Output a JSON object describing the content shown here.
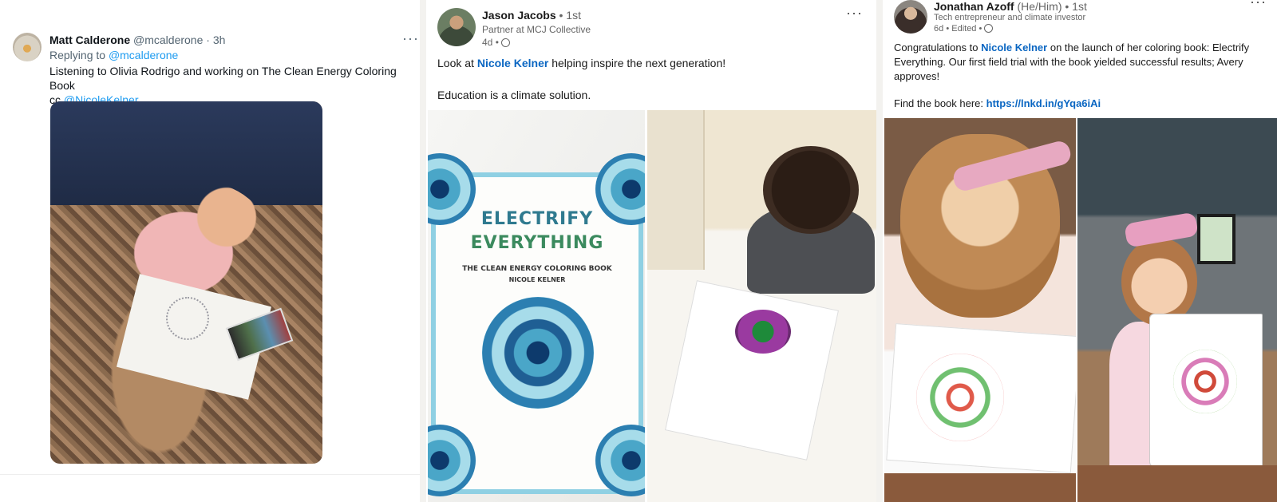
{
  "tweet": {
    "author_name": "Matt Calderone",
    "author_handle": "@mcalderone",
    "time": "3h",
    "more": "···",
    "replying_prefix": "Replying to",
    "replying_handle": "@mcalderone",
    "text": "Listening to Olivia Rodrigo and working on The Clean Energy Coloring Book",
    "cc_prefix": "cc",
    "cc_handle": "@NicoleKelner"
  },
  "post1": {
    "author_name": "Jason Jacobs",
    "degree": "1st",
    "headline": "Partner at MCJ Collective",
    "time": "4d",
    "more": "···",
    "text_prefix": "Look at",
    "mention": "Nicole Kelner",
    "text_suffix": "helping inspire the next generation!",
    "text_line2": "Education is a climate solution.",
    "book_title_1": "ELECTRIFY",
    "book_title_2": "EVERYTHING",
    "book_subtitle": "THE CLEAN ENERGY COLORING BOOK",
    "book_author": "NICOLE KELNER"
  },
  "post2": {
    "author_name": "Jonathan Azoff",
    "pronouns": "(He/Him)",
    "degree": "1st",
    "headline": "Tech entrepreneur and climate investor",
    "time": "6d",
    "edited": "Edited",
    "more": "···",
    "text_prefix": "Congratulations to",
    "mention": "Nicole Kelner",
    "text_suffix": "on the launch of her coloring book: Electrify Everything. Our first field trial with the book yielded successful results; Avery approves!",
    "link_prefix": "Find the book here:",
    "link": "https://lnkd.in/gYqa6iAi"
  },
  "colors": {
    "linkedin_link": "#0a66c2",
    "twitter_link": "#1d9bf0"
  }
}
